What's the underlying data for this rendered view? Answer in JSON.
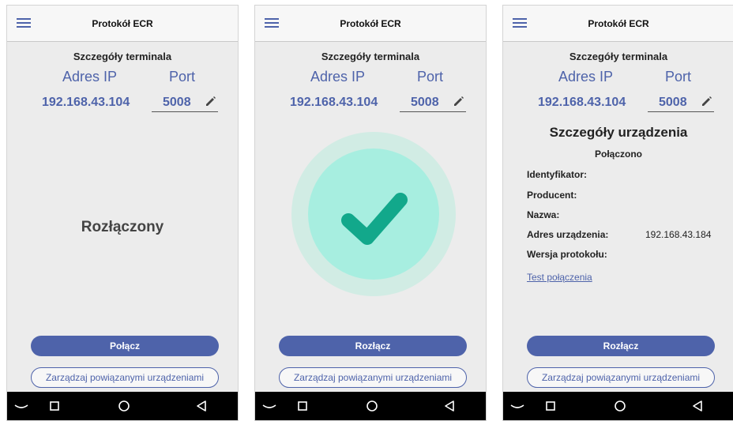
{
  "app": {
    "title": "Protokół ECR"
  },
  "terminal": {
    "section_title": "Szczegóły terminala",
    "ip_label": "Adres IP",
    "port_label": "Port",
    "ip_value": "192.168.43.104",
    "port_value": "5008"
  },
  "screens": [
    {
      "status": "Rozłączony",
      "primary_button": "Połącz",
      "manage_button": "Zarządzaj powiązanymi urządzeniami"
    },
    {
      "status_icon": "check-icon",
      "primary_button": "Rozłącz",
      "manage_button": "Zarządzaj powiązanymi urządzeniami"
    },
    {
      "device_title": "Szczegóły urządzenia",
      "device_status": "Połączono",
      "fields": [
        {
          "label": "Identyfikator:",
          "value": ""
        },
        {
          "label": "Producent:",
          "value": ""
        },
        {
          "label": "Nazwa:",
          "value": ""
        },
        {
          "label": "Adres urządzenia:",
          "value": "192.168.43.184"
        },
        {
          "label": "Wersja protokołu:",
          "value": ""
        }
      ],
      "test_link": "Test połączenia",
      "primary_button": "Rozłącz",
      "manage_button": "Zarządzaj powiązanymi urządzeniami"
    }
  ],
  "nav_icons": [
    "back-icon",
    "home-icon",
    "recents-icon",
    "keyboard-hide-icon"
  ],
  "colors": {
    "accent": "#4e63aa",
    "check_outer": "#d1ece4",
    "check_inner": "#a7eee0",
    "check_mark": "#12a88b"
  }
}
